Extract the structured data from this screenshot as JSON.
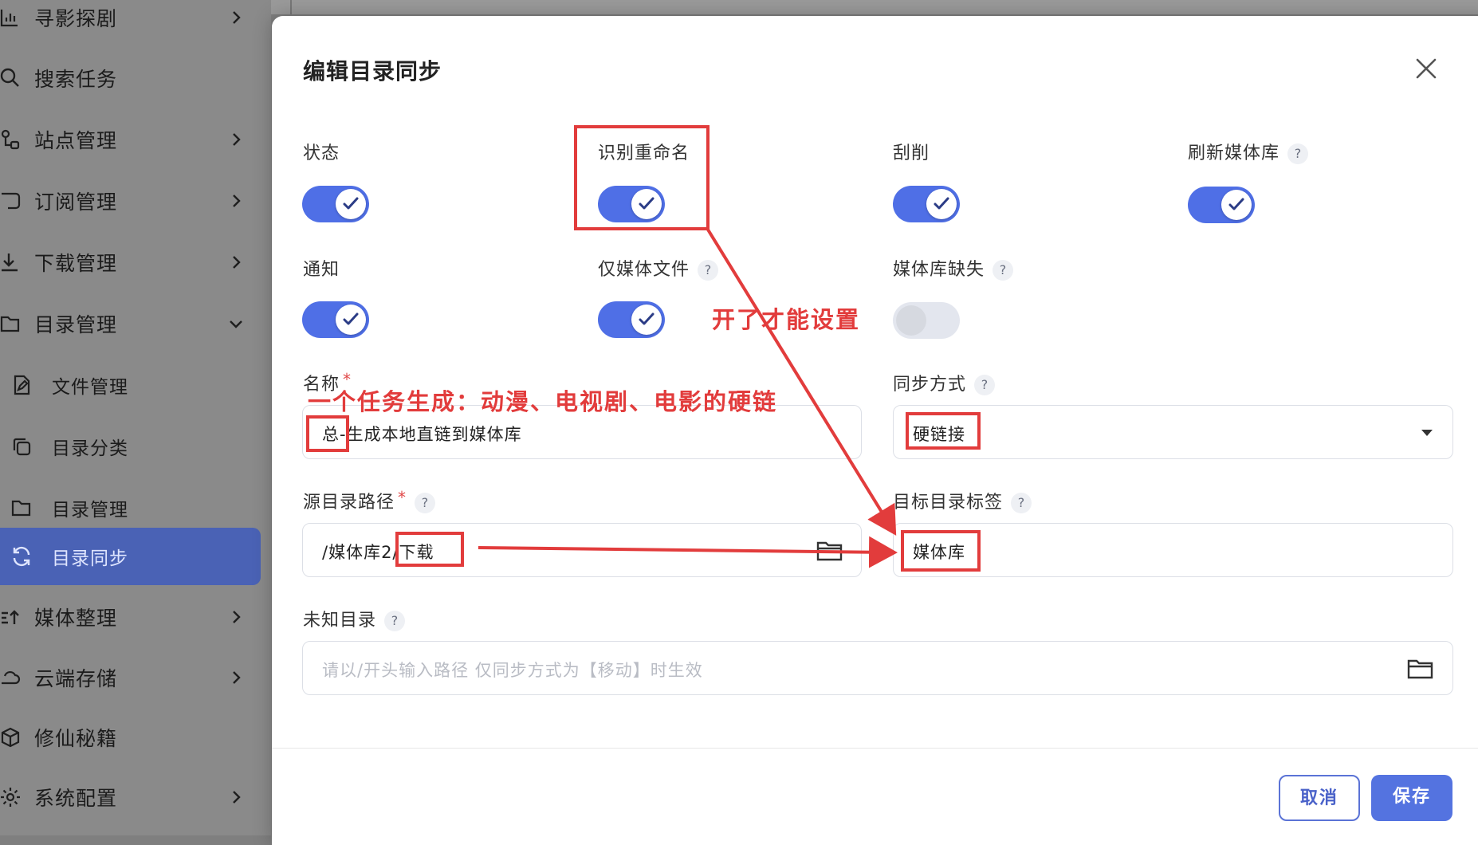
{
  "sidebar": {
    "items": [
      {
        "label": "寻影探剧",
        "icon": "bar-chart-icon",
        "chevron": true
      },
      {
        "label": "搜索任务",
        "icon": "search-icon",
        "chevron": false
      },
      {
        "label": "站点管理",
        "icon": "site-network-icon",
        "chevron": true
      },
      {
        "label": "订阅管理",
        "icon": "rss-icon",
        "chevron": true
      },
      {
        "label": "下载管理",
        "icon": "download-icon",
        "chevron": true
      },
      {
        "label": "目录管理",
        "icon": "folder-icon",
        "chevron": true
      },
      {
        "label": "文件管理",
        "icon": "file-edit-icon"
      },
      {
        "label": "目录分类",
        "icon": "copy-icon"
      },
      {
        "label": "目录管理",
        "icon": "folder-icon"
      },
      {
        "label": "目录同步",
        "icon": "sync-icon",
        "active": true
      },
      {
        "label": "媒体整理",
        "icon": "sort-arrows-icon",
        "chevron": true
      },
      {
        "label": "云端存储",
        "icon": "cloud-icon",
        "chevron": true
      },
      {
        "label": "修仙秘籍",
        "icon": "cube-icon",
        "chevron": false
      },
      {
        "label": "系统配置",
        "icon": "gear-icon",
        "chevron": true
      }
    ]
  },
  "dialog": {
    "title": "编辑目录同步",
    "toggles": {
      "status": {
        "label": "状态",
        "on": true
      },
      "rename": {
        "label": "识别重命名",
        "on": true
      },
      "scrape": {
        "label": "刮削",
        "on": true
      },
      "refresh": {
        "label": "刷新媒体库",
        "on": true,
        "help": "?"
      },
      "notify": {
        "label": "通知",
        "on": true
      },
      "media_only": {
        "label": "仅媒体文件",
        "on": true,
        "help": "?"
      },
      "library_missing": {
        "label": "媒体库缺失",
        "on": false,
        "help": "?"
      }
    },
    "name": {
      "label": "名称",
      "required": "*",
      "value": "总-生成本地直链到媒体库"
    },
    "sync_mode": {
      "label": "同步方式",
      "help": "?",
      "value": "硬链接"
    },
    "source_path": {
      "label": "源目录路径",
      "required": "*",
      "help": "?",
      "value": "/媒体库2/下载"
    },
    "target_label": {
      "label": "目标目录标签",
      "help": "?",
      "value": "媒体库"
    },
    "unknown_dir": {
      "label": "未知目录",
      "help": "?",
      "placeholder": "请以/开头输入路径 仅同步方式为【移动】时生效"
    },
    "buttons": {
      "cancel": "取消",
      "save": "保存"
    }
  },
  "annotations": {
    "note_enable": "开了才能设置",
    "note_task": "一个任务生成：动漫、电视剧、电影的硬链"
  },
  "colors": {
    "accent": "#4f6fe6",
    "annotation": "#e23c3c",
    "sidebar_active": "#4a62b5"
  }
}
